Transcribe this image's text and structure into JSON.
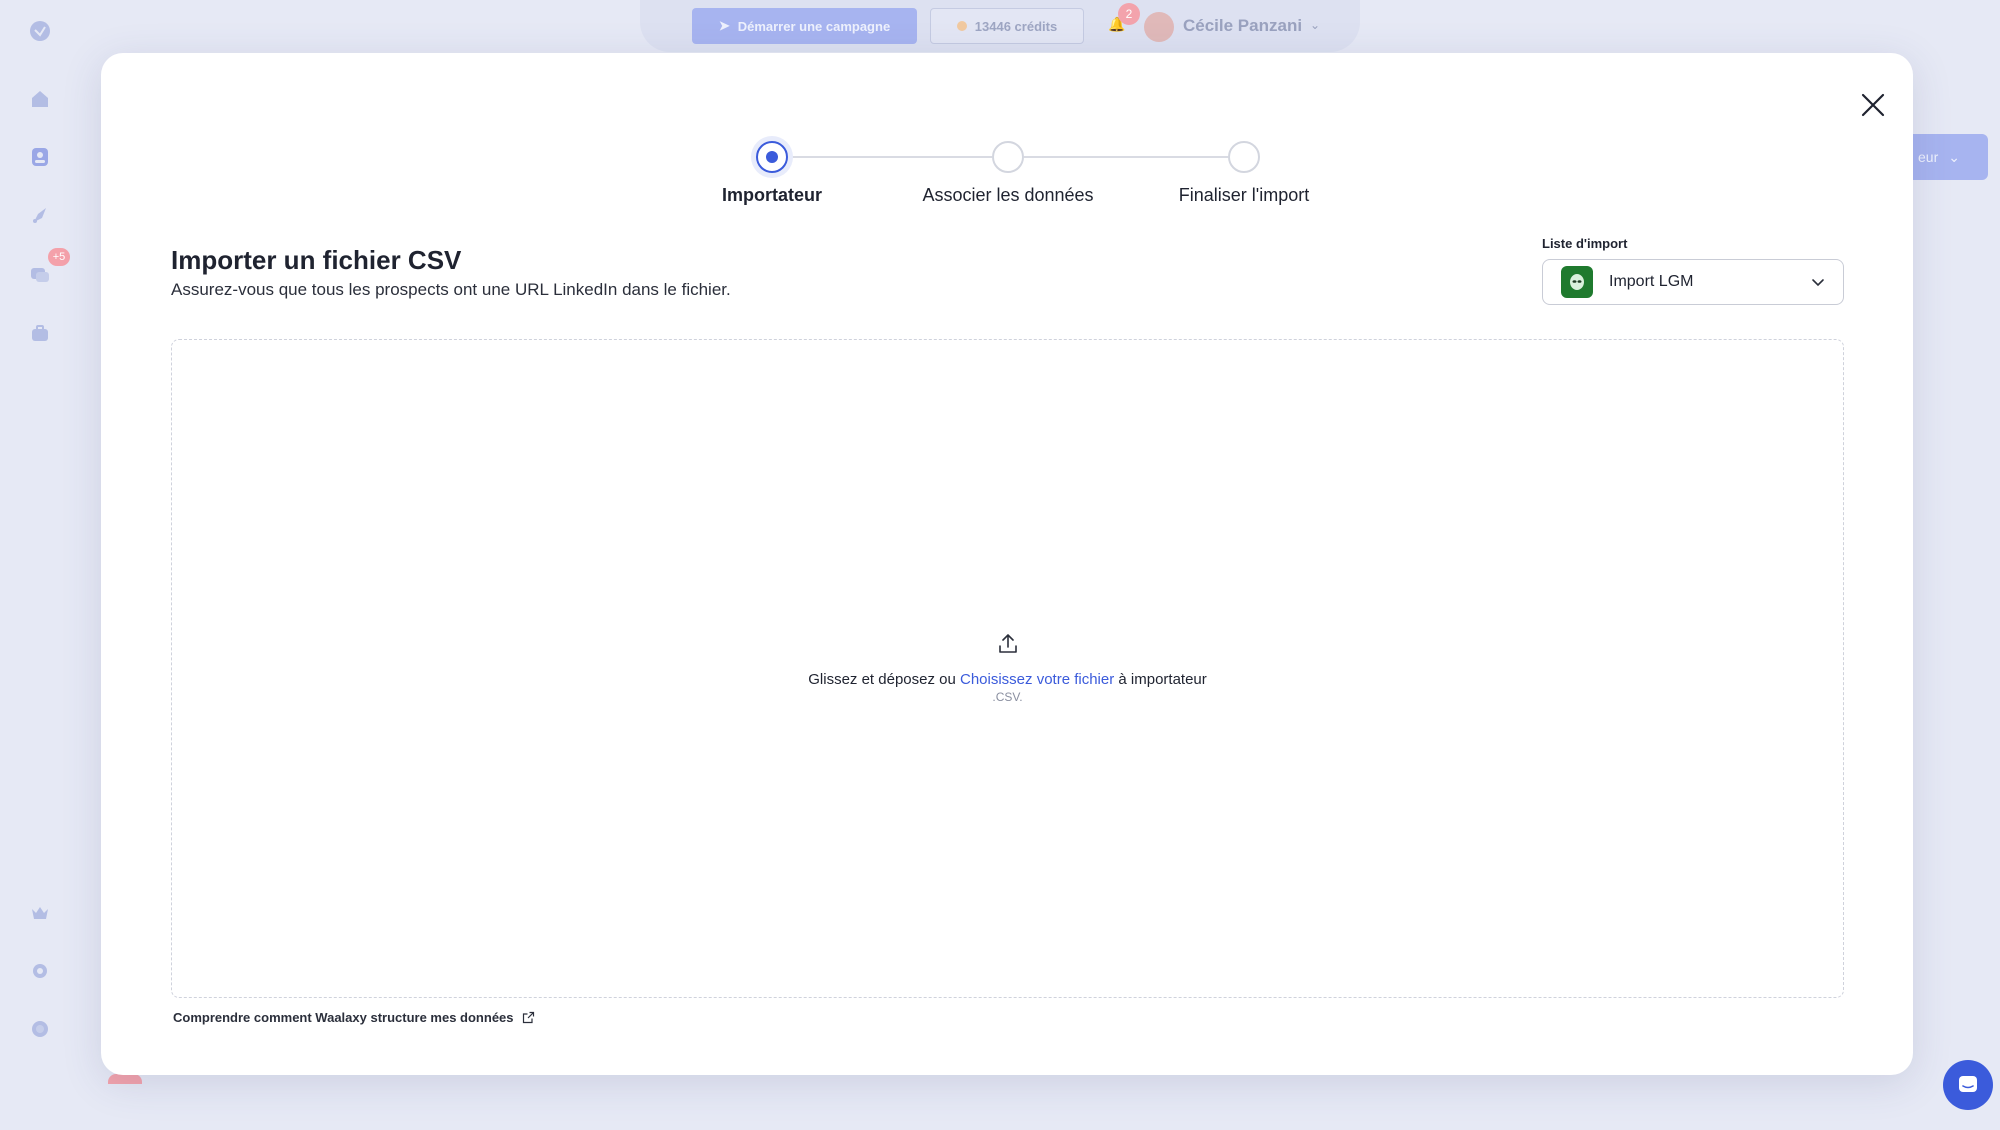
{
  "topbar": {
    "start_campaign": "Démarrer une campagne",
    "credits": "13446 crédits",
    "notifications_count": "2",
    "user_name": "Cécile Panzani"
  },
  "sidebar": {
    "badge": "+5"
  },
  "background": {
    "right_button_label": "eur"
  },
  "stepper": {
    "steps": [
      {
        "label": "Importateur",
        "active": true
      },
      {
        "label": "Associer les données",
        "active": false
      },
      {
        "label": "Finaliser l'import",
        "active": false
      }
    ]
  },
  "modal": {
    "title": "Importer un fichier CSV",
    "subtitle": "Assurez-vous que tous les prospects ont une URL LinkedIn dans le fichier.",
    "import_list_label": "Liste d'import",
    "import_list_value": "Import LGM",
    "dropzone": {
      "prefix": "Glissez et déposez ou ",
      "link": "Choisissez votre fichier",
      "suffix": " à importateur",
      "extensions": ".CSV."
    },
    "help_link": "Comprendre comment Waalaxy structure mes données"
  },
  "colors": {
    "accent": "#3b5bdb",
    "list_icon_bg": "#1f7a2e"
  }
}
